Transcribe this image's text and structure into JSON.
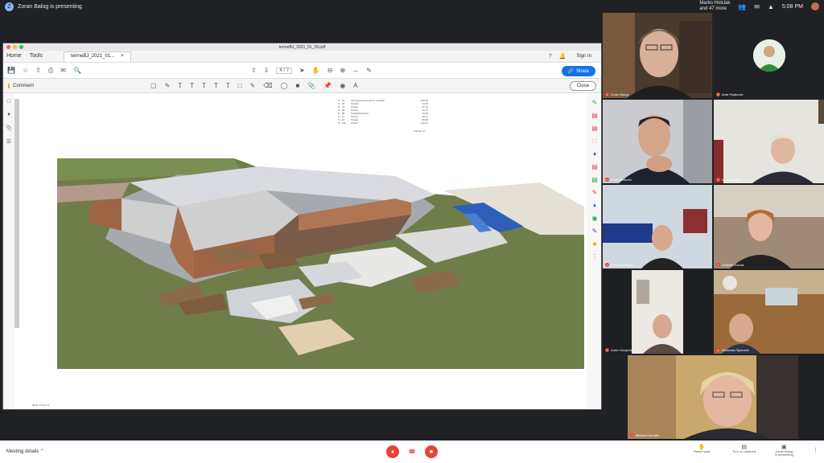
{
  "meet": {
    "presenter_initial": "Z",
    "presenter_text": "Zoran Balog is presenting",
    "pinned_line1": "Marko Holclak",
    "pinned_line2": "and 47 more",
    "time": "5:08 PM",
    "meeting_details": "Meeting details",
    "raise_hand": "Raise hand",
    "turn_on_captions": "Turn on captions",
    "presenting_line1": "Zoran Balog",
    "presenting_line2": "is presenting"
  },
  "acrobat": {
    "doc_title": "termeBJ_2021_01_29.pdf",
    "menu": {
      "home": "Home",
      "tools": "Tools",
      "tab_label": "termeBJ_2021_01...",
      "sign_in": "Sign In"
    },
    "page_indicator": "4 / 7",
    "share_label": "Share",
    "comment_label": "Comment",
    "close_label": "Close",
    "area_table": [
      [
        "N - 01",
        "Ulaz/predvorje/hodnici, stubišta",
        "142,48"
      ],
      [
        "N - 02",
        "Garaža",
        "44,05"
      ],
      [
        "N - 07",
        "Terasa",
        "87,16"
      ],
      [
        "N - 08",
        "Terasa",
        "11,13"
      ],
      [
        "N - 09",
        "Kupalište/bazeni",
        "11,82"
      ],
      [
        "N - 11",
        "Terasa",
        "48,74"
      ],
      [
        "N - 12",
        "Terasa",
        "66,98"
      ],
      [
        "N - 13a",
        "Terasa",
        "115,01"
      ]
    ],
    "area_total": "6 92,26 m²",
    "scale_label": "86,81 x 53,11 m"
  },
  "participants": [
    {
      "name": "Zoran Balog"
    },
    {
      "name": "Ante Pejaković"
    },
    {
      "name": "Ante Ivanković"
    },
    {
      "name": "Vesna Kakai"
    },
    {
      "name": "Goran Hamović"
    },
    {
      "name": "Zdravka Horvat"
    },
    {
      "name": "Antun Konjević"
    },
    {
      "name": "Slobodan Šperanić"
    },
    {
      "name": "Mirjana Horvatić"
    }
  ],
  "icons": {
    "present": "screen-share-icon",
    "mic_off": "mic-off-icon",
    "cam_off": "camera-off-icon",
    "hangup": "hangup-icon"
  }
}
